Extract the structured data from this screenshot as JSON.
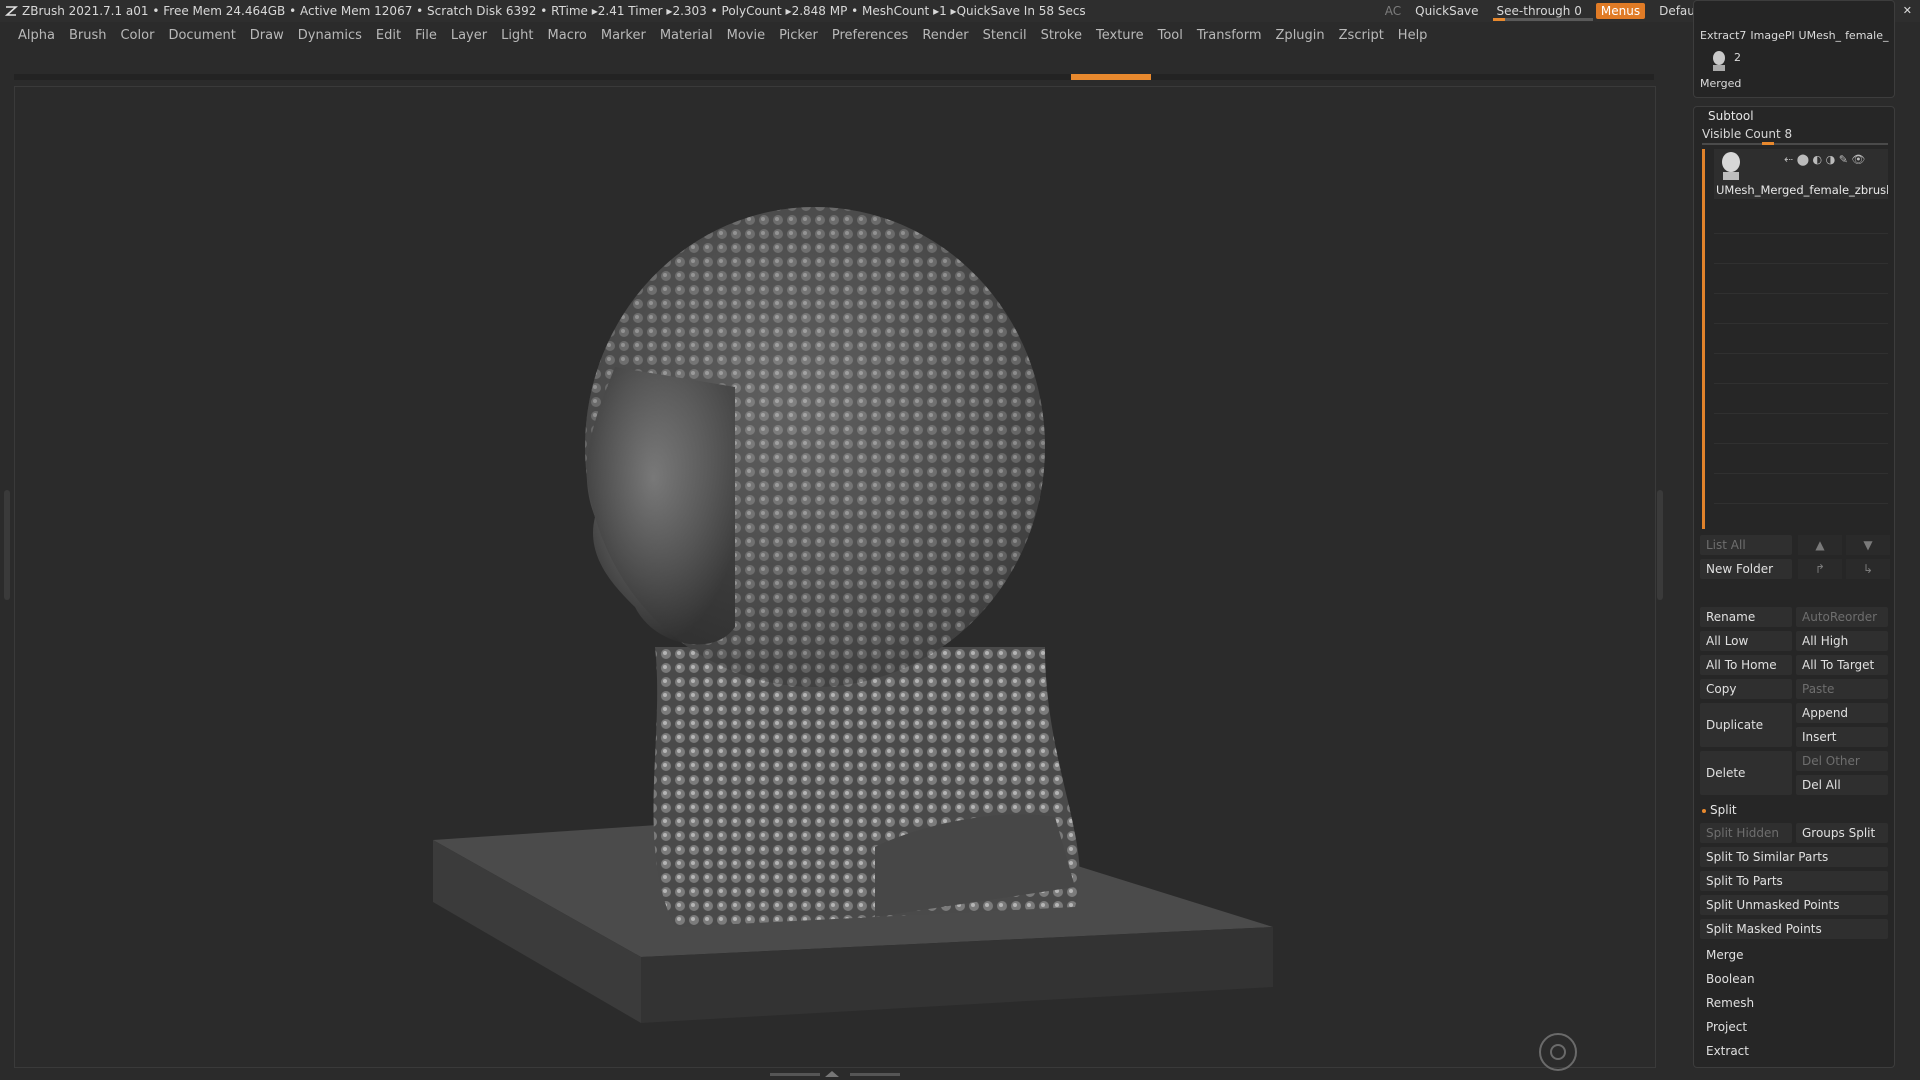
{
  "topbar": {
    "status": "ZBrush 2021.7.1   a01   • Free Mem 24.464GB • Active Mem 12067 • Scratch Disk 6392 •  RTime ▸2.41 Timer ▸2.303 • PolyCount ▸2.848 MP  • MeshCount ▸1   ▸QuickSave In 58 Secs",
    "ac_label": "AC",
    "quicksave_label": "QuickSave",
    "seethrough_label": "See-through",
    "seethrough_value": "0",
    "menus_label": "Menus",
    "script_label": "DefaultZScript"
  },
  "menu": [
    "Alpha",
    "Brush",
    "Color",
    "Document",
    "Draw",
    "Dynamics",
    "Edit",
    "File",
    "Layer",
    "Light",
    "Macro",
    "Marker",
    "Material",
    "Movie",
    "Picker",
    "Preferences",
    "Render",
    "Stencil",
    "Stroke",
    "Texture",
    "Tool",
    "Transform",
    "Zplugin",
    "Zscript",
    "Help"
  ],
  "tool_thumbs": {
    "labels": [
      "Extract7",
      "ImagePl",
      "UMesh_",
      "female_"
    ],
    "merged_label": "Merged",
    "merged_count": "2"
  },
  "subtool": {
    "title": "Subtool",
    "visible_count_label": "Visible Count 8",
    "item_name": "UMesh_Merged_female_zbrush",
    "list_all": "List All",
    "new_folder": "New Folder",
    "buttons": {
      "rename": "Rename",
      "autoreorder": "AutoReorder",
      "all_low": "All Low",
      "all_high": "All High",
      "all_to_home": "All To Home",
      "all_to_target": "All To Target",
      "copy": "Copy",
      "paste": "Paste",
      "duplicate": "Duplicate",
      "append": "Append",
      "insert": "Insert",
      "delete": "Delete",
      "del_other": "Del Other",
      "del_all": "Del All"
    },
    "split_title": "Split",
    "split": {
      "split_hidden": "Split Hidden",
      "groups_split": "Groups Split",
      "split_to_similar_parts": "Split To Similar Parts",
      "split_to_parts": "Split To Parts",
      "split_unmasked_points": "Split Unmasked Points",
      "split_masked_points": "Split Masked Points"
    },
    "sections": {
      "merge": "Merge",
      "boolean": "Boolean",
      "remesh": "Remesh",
      "project": "Project",
      "extract": "Extract"
    }
  }
}
